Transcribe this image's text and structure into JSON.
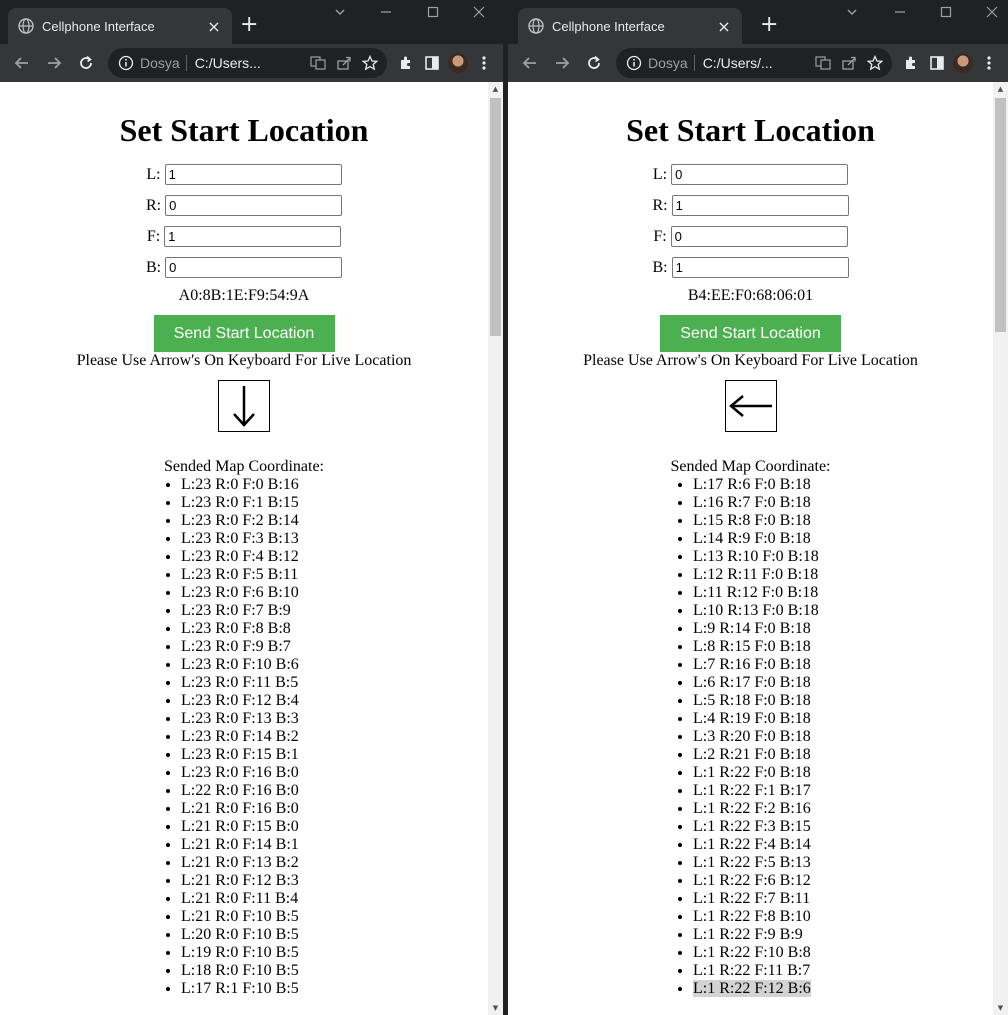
{
  "left": {
    "tab": {
      "title": "Cellphone Interface",
      "close": "×"
    },
    "newtab": "+",
    "omnibox": {
      "scheme": "Dosya",
      "url": "C:/Users..."
    },
    "page": {
      "title": "Set Start Location",
      "fields": [
        {
          "label": "L:",
          "value": "1"
        },
        {
          "label": "R:",
          "value": "0"
        },
        {
          "label": "F:",
          "value": "1"
        },
        {
          "label": "B:",
          "value": "0"
        }
      ],
      "mac": "A0:8B:1E:F9:54:9A",
      "send_button": "Send Start Location",
      "hint": "Please Use Arrow's On Keyboard For Live Location",
      "arrow_direction": "down",
      "coord_title": "Sended Map Coordinate:",
      "coords": [
        "L:23 R:0 F:0 B:16",
        "L:23 R:0 F:1 B:15",
        "L:23 R:0 F:2 B:14",
        "L:23 R:0 F:3 B:13",
        "L:23 R:0 F:4 B:12",
        "L:23 R:0 F:5 B:11",
        "L:23 R:0 F:6 B:10",
        "L:23 R:0 F:7 B:9",
        "L:23 R:0 F:8 B:8",
        "L:23 R:0 F:9 B:7",
        "L:23 R:0 F:10 B:6",
        "L:23 R:0 F:11 B:5",
        "L:23 R:0 F:12 B:4",
        "L:23 R:0 F:13 B:3",
        "L:23 R:0 F:14 B:2",
        "L:23 R:0 F:15 B:1",
        "L:23 R:0 F:16 B:0",
        "L:22 R:0 F:16 B:0",
        "L:21 R:0 F:16 B:0",
        "L:21 R:0 F:15 B:0",
        "L:21 R:0 F:14 B:1",
        "L:21 R:0 F:13 B:2",
        "L:21 R:0 F:12 B:3",
        "L:21 R:0 F:11 B:4",
        "L:21 R:0 F:10 B:5",
        "L:20 R:0 F:10 B:5",
        "L:19 R:0 F:10 B:5",
        "L:18 R:0 F:10 B:5",
        "L:17 R:1 F:10 B:5"
      ]
    }
  },
  "right": {
    "tab": {
      "title": "Cellphone Interface",
      "close": "×"
    },
    "newtab": "+",
    "omnibox": {
      "scheme": "Dosya",
      "url": "C:/Users/..."
    },
    "page": {
      "title": "Set Start Location",
      "fields": [
        {
          "label": "L:",
          "value": "0"
        },
        {
          "label": "R:",
          "value": "1"
        },
        {
          "label": "F:",
          "value": "0"
        },
        {
          "label": "B:",
          "value": "1"
        }
      ],
      "mac": "B4:EE:F0:68:06:01",
      "send_button": "Send Start Location",
      "hint": "Please Use Arrow's On Keyboard For Live Location",
      "arrow_direction": "left",
      "coord_title": "Sended Map Coordinate:",
      "coords": [
        "L:17 R:6 F:0 B:18",
        "L:16 R:7 F:0 B:18",
        "L:15 R:8 F:0 B:18",
        "L:14 R:9 F:0 B:18",
        "L:13 R:10 F:0 B:18",
        "L:12 R:11 F:0 B:18",
        "L:11 R:12 F:0 B:18",
        "L:10 R:13 F:0 B:18",
        "L:9 R:14 F:0 B:18",
        "L:8 R:15 F:0 B:18",
        "L:7 R:16 F:0 B:18",
        "L:6 R:17 F:0 B:18",
        "L:5 R:18 F:0 B:18",
        "L:4 R:19 F:0 B:18",
        "L:3 R:20 F:0 B:18",
        "L:2 R:21 F:0 B:18",
        "L:1 R:22 F:0 B:18",
        "L:1 R:22 F:1 B:17",
        "L:1 R:22 F:2 B:16",
        "L:1 R:22 F:3 B:15",
        "L:1 R:22 F:4 B:14",
        "L:1 R:22 F:5 B:13",
        "L:1 R:22 F:6 B:12",
        "L:1 R:22 F:7 B:11",
        "L:1 R:22 F:8 B:10",
        "L:1 R:22 F:9 B:9",
        "L:1 R:22 F:10 B:8",
        "L:1 R:22 F:11 B:7",
        "L:1 R:22 F:12 B:6"
      ],
      "highlighted_coord": "L:1 R:22 F:12 B:6"
    }
  }
}
